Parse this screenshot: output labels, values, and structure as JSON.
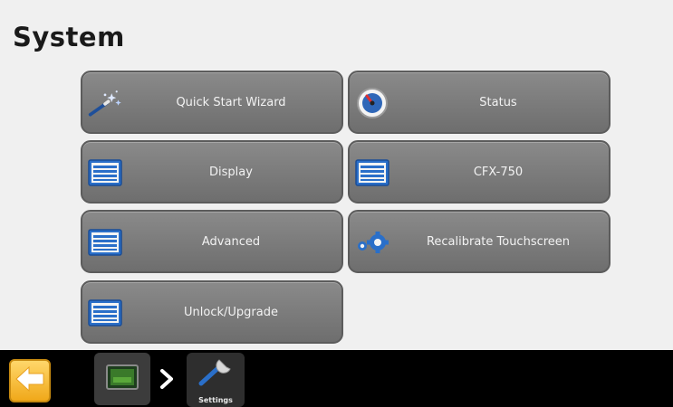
{
  "page": {
    "title": "System"
  },
  "menu": {
    "quick_start_wizard": {
      "label": "Quick Start Wizard",
      "icon": "wand-icon"
    },
    "status": {
      "label": "Status",
      "icon": "gauge-icon"
    },
    "display": {
      "label": "Display",
      "icon": "list-icon"
    },
    "cfx750": {
      "label": "CFX-750",
      "icon": "list-icon"
    },
    "advanced": {
      "label": "Advanced",
      "icon": "list-icon"
    },
    "recalibrate": {
      "label": "Recalibrate Touchscreen",
      "icon": "gears-icon"
    },
    "unlock": {
      "label": "Unlock/Upgrade",
      "icon": "list-icon"
    }
  },
  "bottom_bar": {
    "back": {
      "icon": "back-arrow-icon"
    },
    "breadcrumb": {
      "home": {
        "icon": "home-screen-icon"
      },
      "separator": {
        "icon": "chevron-right-icon"
      },
      "settings": {
        "label": "Settings",
        "icon": "wrench-icon"
      }
    }
  },
  "colors": {
    "background": "#f0f0f0",
    "button": "#7a7a7a",
    "button_text": "#f2f2f2",
    "bar": "#000000",
    "back_accent": "#f5b52a",
    "list_icon_blue": "#2a6fc9"
  }
}
